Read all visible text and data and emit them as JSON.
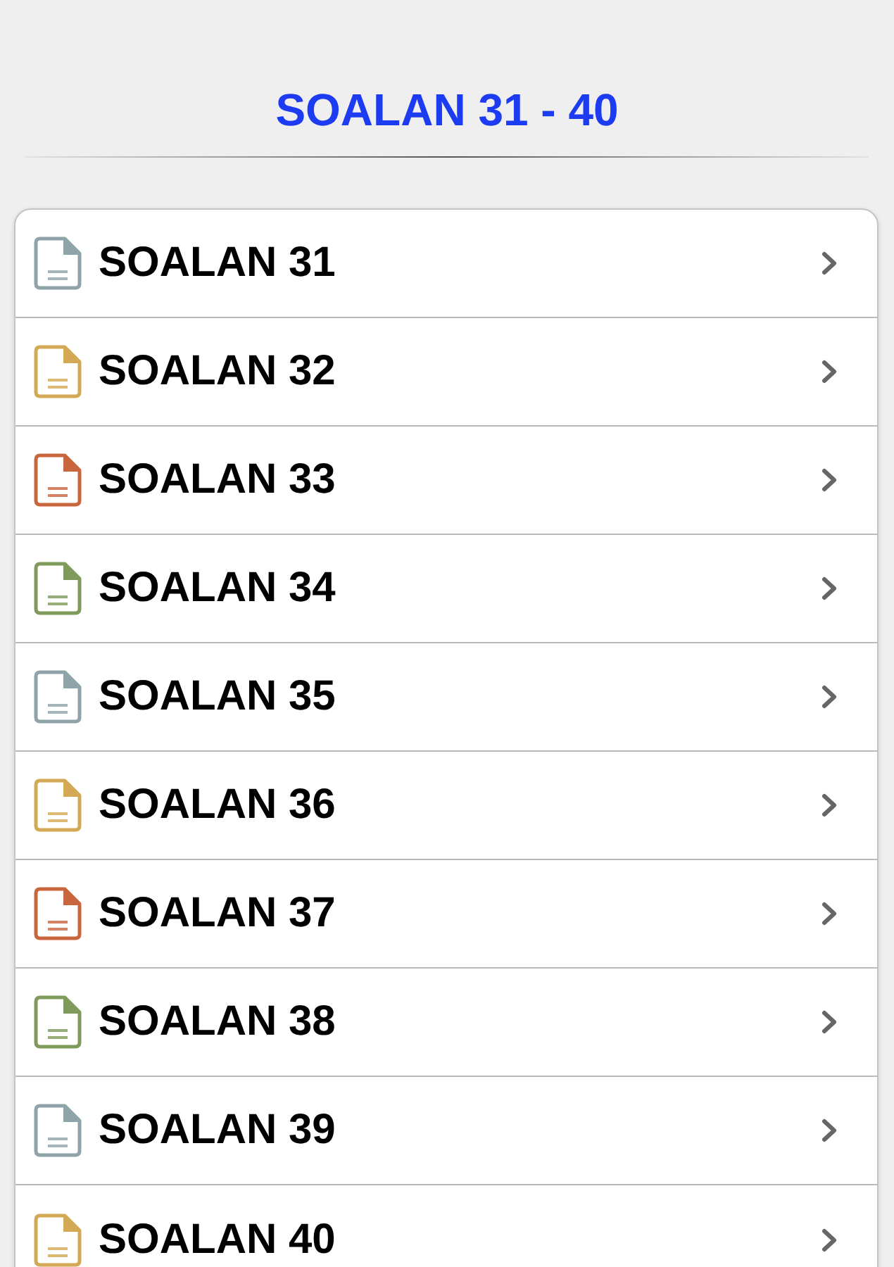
{
  "header": {
    "title": "SOALAN 31 - 40"
  },
  "items": [
    {
      "label": "SOALAN 31",
      "color": "#8fa3aa"
    },
    {
      "label": "SOALAN 32",
      "color": "#d4a955"
    },
    {
      "label": "SOALAN 33",
      "color": "#c9663e"
    },
    {
      "label": "SOALAN 34",
      "color": "#7f9a5a"
    },
    {
      "label": "SOALAN 35",
      "color": "#8fa3aa"
    },
    {
      "label": "SOALAN 36",
      "color": "#d4a955"
    },
    {
      "label": "SOALAN 37",
      "color": "#c9663e"
    },
    {
      "label": "SOALAN 38",
      "color": "#7f9a5a"
    },
    {
      "label": "SOALAN 39",
      "color": "#8fa3aa"
    },
    {
      "label": "SOALAN 40",
      "color": "#d4a955"
    }
  ]
}
